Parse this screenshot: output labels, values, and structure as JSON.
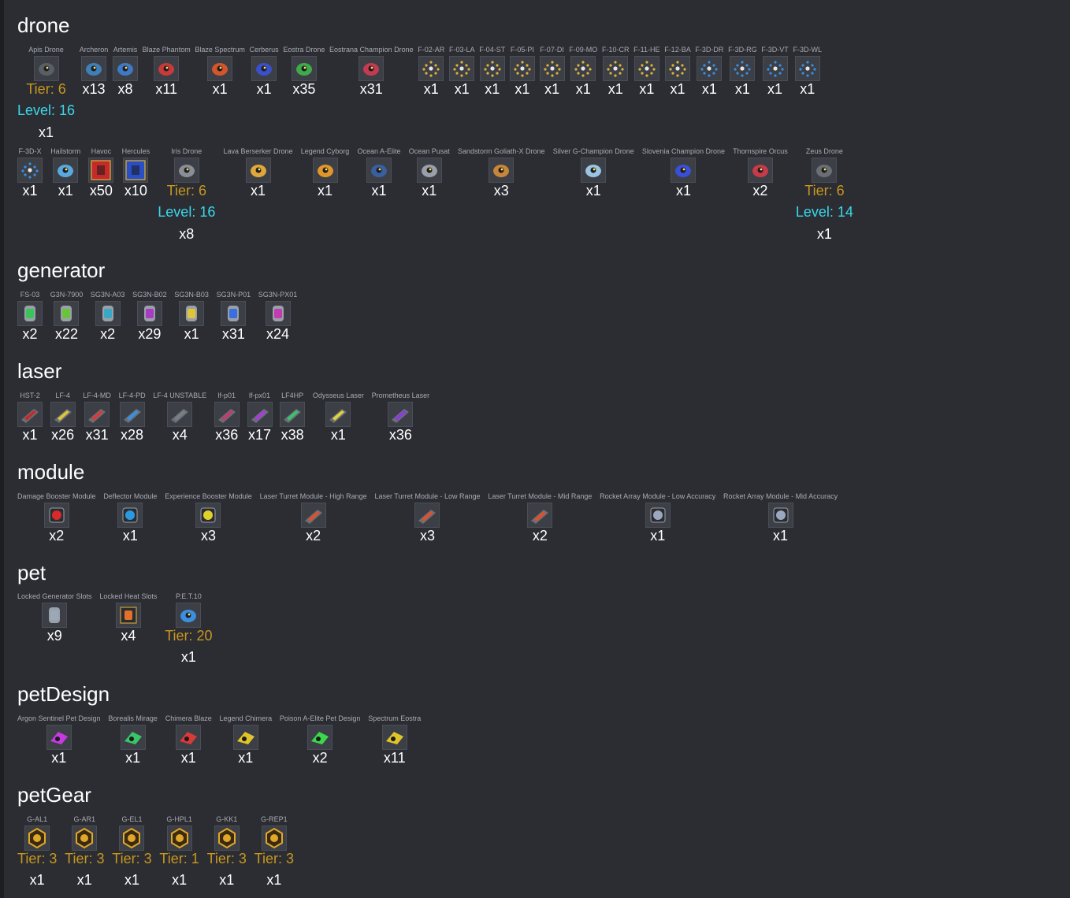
{
  "colors": {
    "background": "#2b2d33",
    "tier_text": "#c9971e",
    "level_text": "#3bd8ea",
    "name_text": "#a9abb2"
  },
  "sections": [
    {
      "key": "drone",
      "title": "drone",
      "rows": [
        [
          {
            "name": "Apis Drone",
            "tier": "Tier: 6",
            "level": "Level: 16",
            "qty": "x1",
            "icon": "apis-drone-icon",
            "color": "#5a5f66"
          },
          {
            "name": "Archeron",
            "qty": "x13",
            "icon": "archeron-drone-icon",
            "color": "#3f7fb8"
          },
          {
            "name": "Artemis",
            "qty": "x8",
            "icon": "artemis-drone-icon",
            "color": "#3f79c4"
          },
          {
            "name": "Blaze Phantom",
            "qty": "x11",
            "icon": "blaze-phantom-drone-icon",
            "color": "#c83a3a"
          },
          {
            "name": "Blaze Spectrum",
            "qty": "x1",
            "icon": "blaze-spectrum-drone-icon",
            "color": "#d4552b"
          },
          {
            "name": "Cerberus",
            "qty": "x1",
            "icon": "cerberus-drone-icon",
            "color": "#3a4fc8"
          },
          {
            "name": "Eostra Drone",
            "qty": "x35",
            "icon": "eostra-drone-icon",
            "color": "#3faa4a"
          },
          {
            "name": "Eostrana Champion Drone",
            "qty": "x31",
            "icon": "eostrana-champion-drone-icon",
            "color": "#c43a50"
          },
          {
            "name": "F-02-AR",
            "qty": "x1",
            "icon": "formation-f02-ar-icon",
            "color": "#e0b23a"
          },
          {
            "name": "F-03-LA",
            "qty": "x1",
            "icon": "formation-f03-la-icon",
            "color": "#e0b23a"
          },
          {
            "name": "F-04-ST",
            "qty": "x1",
            "icon": "formation-f04-st-icon",
            "color": "#e0b23a"
          },
          {
            "name": "F-05-PI",
            "qty": "x1",
            "icon": "formation-f05-pi-icon",
            "color": "#e0b23a"
          },
          {
            "name": "F-07-DI",
            "qty": "x1",
            "icon": "formation-f07-di-icon",
            "color": "#e0b23a"
          },
          {
            "name": "F-09-MO",
            "qty": "x1",
            "icon": "formation-f09-mo-icon",
            "color": "#e0b23a"
          },
          {
            "name": "F-10-CR",
            "qty": "x1",
            "icon": "formation-f10-cr-icon",
            "color": "#e0b23a"
          },
          {
            "name": "F-11-HE",
            "qty": "x1",
            "icon": "formation-f11-he-icon",
            "color": "#e0b23a"
          },
          {
            "name": "F-12-BA",
            "qty": "x1",
            "icon": "formation-f12-ba-icon",
            "color": "#e0b23a"
          },
          {
            "name": "F-3D-DR",
            "qty": "x1",
            "icon": "formation-f3d-dr-icon",
            "color": "#3a8fe0"
          },
          {
            "name": "F-3D-RG",
            "qty": "x1",
            "icon": "formation-f3d-rg-icon",
            "color": "#3a8fe0"
          },
          {
            "name": "F-3D-VT",
            "qty": "x1",
            "icon": "formation-f3d-vt-icon",
            "color": "#3a8fe0"
          },
          {
            "name": "F-3D-WL",
            "qty": "x1",
            "icon": "formation-f3d-wl-icon",
            "color": "#3a8fe0"
          }
        ],
        [
          {
            "name": "F-3D-X",
            "qty": "x1",
            "icon": "formation-f3d-x-icon",
            "color": "#3a8fe0"
          },
          {
            "name": "Hailstorm",
            "qty": "x1",
            "icon": "hailstorm-drone-icon",
            "color": "#5aa8e0"
          },
          {
            "name": "Havoc",
            "qty": "x50",
            "icon": "havoc-design-icon",
            "color": "#c42a2a"
          },
          {
            "name": "Hercules",
            "qty": "x10",
            "icon": "hercules-design-icon",
            "color": "#2a4fc4"
          },
          {
            "name": "Iris Drone",
            "tier": "Tier: 6",
            "level": "Level: 16",
            "qty": "x8",
            "icon": "iris-drone-icon",
            "color": "#8a8f96"
          },
          {
            "name": "Lava Berserker Drone",
            "qty": "x1",
            "icon": "lava-berserker-drone-icon",
            "color": "#e0a83a"
          },
          {
            "name": "Legend Cyborg",
            "qty": "x1",
            "icon": "legend-cyborg-drone-icon",
            "color": "#e0962a"
          },
          {
            "name": "Ocean A-Elite",
            "qty": "x1",
            "icon": "ocean-a-elite-drone-icon",
            "color": "#3a5fa0"
          },
          {
            "name": "Ocean Pusat",
            "qty": "x1",
            "icon": "ocean-pusat-drone-icon",
            "color": "#9aa0a8"
          },
          {
            "name": "Sandstorm Goliath-X Drone",
            "qty": "x3",
            "icon": "sandstorm-goliath-x-drone-icon",
            "color": "#c8863a"
          },
          {
            "name": "Silver G-Champion Drone",
            "qty": "x1",
            "icon": "silver-g-champion-drone-icon",
            "color": "#9ac4e0"
          },
          {
            "name": "Slovenia Champion Drone",
            "qty": "x1",
            "icon": "slovenia-champion-drone-icon",
            "color": "#3a4fd8"
          },
          {
            "name": "Thornspire Orcus",
            "qty": "x2",
            "icon": "thornspire-orcus-drone-icon",
            "color": "#c83a4a"
          },
          {
            "name": "Zeus Drone",
            "tier": "Tier: 6",
            "level": "Level: 14",
            "qty": "x1",
            "icon": "zeus-drone-icon",
            "color": "#6a6f76"
          }
        ]
      ]
    },
    {
      "key": "generator",
      "title": "generator",
      "rows": [
        [
          {
            "name": "FS-03",
            "qty": "x2",
            "icon": "fs-03-generator-icon",
            "color": "#3ac45a"
          },
          {
            "name": "G3N-7900",
            "qty": "x22",
            "icon": "g3n-7900-generator-icon",
            "color": "#6ac43a"
          },
          {
            "name": "SG3N-A03",
            "qty": "x2",
            "icon": "sg3n-a03-generator-icon",
            "color": "#3aa8c4"
          },
          {
            "name": "SG3N-B02",
            "qty": "x29",
            "icon": "sg3n-b02-generator-icon",
            "color": "#a83ac4"
          },
          {
            "name": "SG3N-B03",
            "qty": "x1",
            "icon": "sg3n-b03-generator-icon",
            "color": "#e0c43a"
          },
          {
            "name": "SG3N-P01",
            "qty": "x31",
            "icon": "sg3n-p01-generator-icon",
            "color": "#3a6fe0"
          },
          {
            "name": "SG3N-PX01",
            "qty": "x24",
            "icon": "sg3n-px01-generator-icon",
            "color": "#c43ab0"
          }
        ]
      ]
    },
    {
      "key": "laser",
      "title": "laser",
      "rows": [
        [
          {
            "name": "HST-2",
            "qty": "x1",
            "icon": "hst-2-laser-icon",
            "color": "#c42a2a"
          },
          {
            "name": "LF-4",
            "qty": "x26",
            "icon": "lf-4-laser-icon",
            "color": "#e0c43a"
          },
          {
            "name": "LF-4-MD",
            "qty": "x31",
            "icon": "lf-4-md-laser-icon",
            "color": "#d83a3a"
          },
          {
            "name": "LF-4-PD",
            "qty": "x28",
            "icon": "lf-4-pd-laser-icon",
            "color": "#3a8fe0"
          },
          {
            "name": "LF-4 UNSTABLE",
            "qty": "x4",
            "icon": "lf-4-unstable-laser-icon",
            "color": "#7a7f86"
          },
          {
            "name": "lf-p01",
            "qty": "x36",
            "icon": "lf-p01-laser-icon",
            "color": "#c43a6a"
          },
          {
            "name": "lf-px01",
            "qty": "x17",
            "icon": "lf-px01-laser-icon",
            "color": "#a83ae0"
          },
          {
            "name": "LF4HP",
            "qty": "x38",
            "icon": "lf4hp-laser-icon",
            "color": "#3ac46a"
          },
          {
            "name": "Odysseus Laser",
            "qty": "x1",
            "icon": "odysseus-laser-icon",
            "color": "#e0d23a"
          },
          {
            "name": "Prometheus Laser",
            "qty": "x36",
            "icon": "prometheus-laser-icon",
            "color": "#8a3ae0"
          }
        ]
      ]
    },
    {
      "key": "module",
      "title": "module",
      "rows": [
        [
          {
            "name": "Damage Booster Module",
            "qty": "x2",
            "icon": "damage-booster-module-icon",
            "color": "#d82a2a"
          },
          {
            "name": "Deflector Module",
            "qty": "x1",
            "icon": "deflector-module-icon",
            "color": "#2a9ae0"
          },
          {
            "name": "Experience Booster Module",
            "qty": "x3",
            "icon": "experience-booster-module-icon",
            "color": "#e0d22a"
          },
          {
            "name": "Laser Turret Module - High Range",
            "qty": "x2",
            "icon": "laser-turret-high-range-icon",
            "color": "#e0502a"
          },
          {
            "name": "Laser Turret Module - Low Range",
            "qty": "x3",
            "icon": "laser-turret-low-range-icon",
            "color": "#e0502a"
          },
          {
            "name": "Laser Turret Module - Mid Range",
            "qty": "x2",
            "icon": "laser-turret-mid-range-icon",
            "color": "#e0502a"
          },
          {
            "name": "Rocket Array Module - Low Accuracy",
            "qty": "x1",
            "icon": "rocket-array-low-accuracy-icon",
            "color": "#9aa8c0"
          },
          {
            "name": "Rocket Array Module - Mid Accuracy",
            "qty": "x1",
            "icon": "rocket-array-mid-accuracy-icon",
            "color": "#9aa8c0"
          }
        ]
      ]
    },
    {
      "key": "pet",
      "title": "pet",
      "rows": [
        [
          {
            "name": "Locked Generator Slots",
            "qty": "x9",
            "icon": "locked-generator-slot-icon",
            "color": "#9aa8b8"
          },
          {
            "name": "Locked Heat Slots",
            "qty": "x4",
            "icon": "locked-heat-slot-icon",
            "color": "#e0702a"
          },
          {
            "name": "P.E.T.10",
            "tier": "Tier: 20",
            "qty": "x1",
            "icon": "pet-10-icon",
            "color": "#3a8fe0"
          }
        ]
      ]
    },
    {
      "key": "petDesign",
      "title": "petDesign",
      "rows": [
        [
          {
            "name": "Argon Sentinel Pet Design",
            "qty": "x1",
            "icon": "argon-sentinel-pet-design-icon",
            "color": "#c43ae0"
          },
          {
            "name": "Borealis Mirage",
            "qty": "x1",
            "icon": "borealis-mirage-pet-design-icon",
            "color": "#3ac46a"
          },
          {
            "name": "Chimera Blaze",
            "qty": "x1",
            "icon": "chimera-blaze-pet-design-icon",
            "color": "#d83a3a"
          },
          {
            "name": "Legend Chimera",
            "qty": "x1",
            "icon": "legend-chimera-pet-design-icon",
            "color": "#e0c42a"
          },
          {
            "name": "Poison A-Elite Pet Design",
            "qty": "x2",
            "icon": "poison-a-elite-pet-design-icon",
            "color": "#3ad84a"
          },
          {
            "name": "Spectrum Eostra",
            "qty": "x11",
            "icon": "spectrum-eostra-pet-design-icon",
            "color": "#e0c42a"
          }
        ]
      ]
    },
    {
      "key": "petGear",
      "title": "petGear",
      "rows": [
        [
          {
            "name": "G-AL1",
            "tier": "Tier: 3",
            "qty": "x1",
            "icon": "g-al1-gear-icon",
            "color": "#e0a82a"
          },
          {
            "name": "G-AR1",
            "tier": "Tier: 3",
            "qty": "x1",
            "icon": "g-ar1-gear-icon",
            "color": "#e0a82a"
          },
          {
            "name": "G-EL1",
            "tier": "Tier: 3",
            "qty": "x1",
            "icon": "g-el1-gear-icon",
            "color": "#e0a82a"
          },
          {
            "name": "G-HPL1",
            "tier": "Tier: 1",
            "qty": "x1",
            "icon": "g-hpl1-gear-icon",
            "color": "#e0a82a"
          },
          {
            "name": "G-KK1",
            "tier": "Tier: 3",
            "qty": "x1",
            "icon": "g-kk1-gear-icon",
            "color": "#e0a82a"
          },
          {
            "name": "G-REP1",
            "tier": "Tier: 3",
            "qty": "x1",
            "icon": "g-rep1-gear-icon",
            "color": "#e0a82a"
          }
        ]
      ]
    }
  ]
}
